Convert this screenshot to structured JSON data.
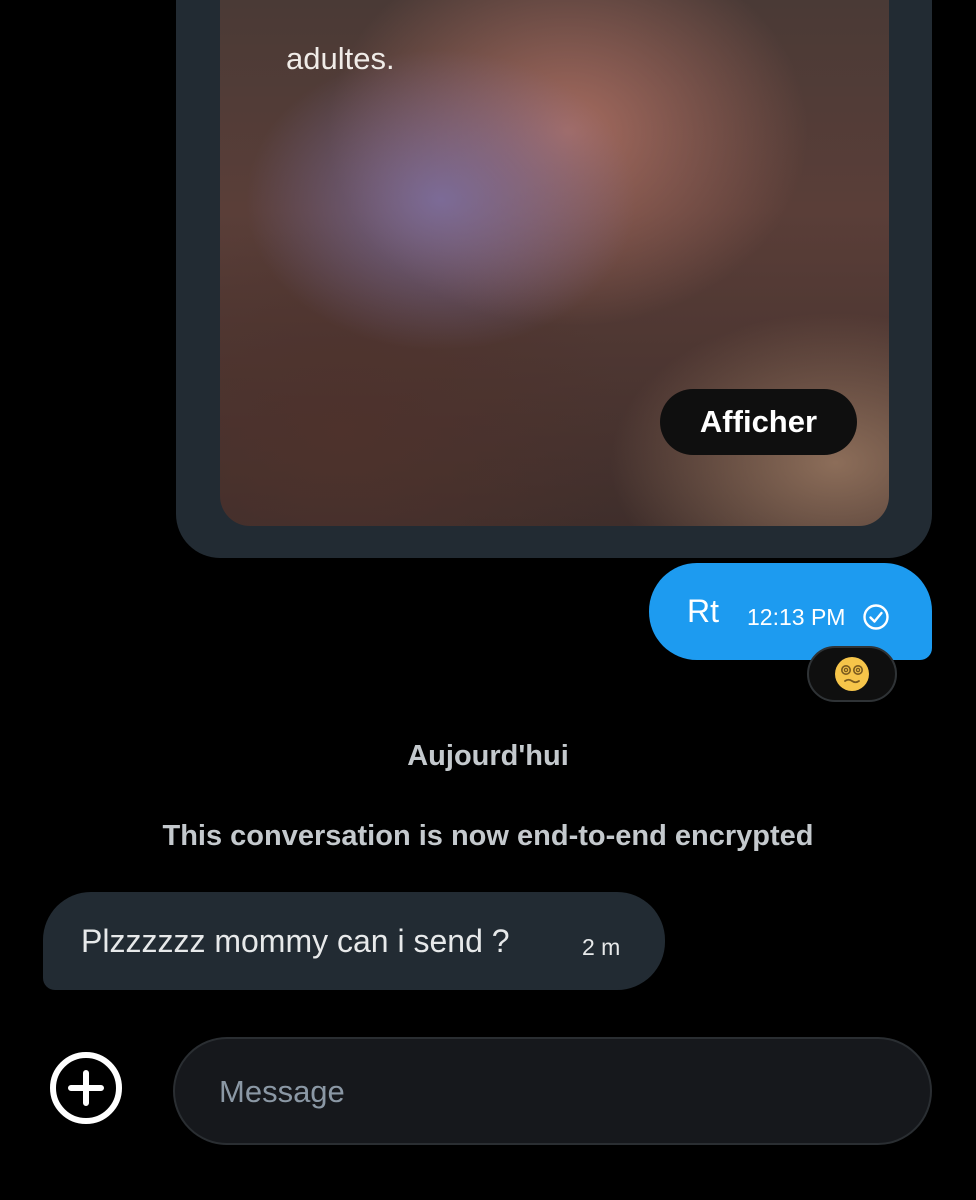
{
  "media": {
    "caption": "adultes.",
    "show_label": "Afficher"
  },
  "outgoing_message": {
    "text": "Rt",
    "time": "12:13 PM",
    "status_icon": "check-circle-icon",
    "reaction_icon": "dizzy-face-emoji"
  },
  "date_separator": "Aujourd'hui",
  "system_note": "This conversation is now end-to-end encrypted",
  "incoming_message": {
    "text": "Plzzzzzz mommy can i send ?",
    "time": "2 m"
  },
  "composer": {
    "placeholder": "Message",
    "value": "",
    "add_icon": "plus-circle-icon"
  },
  "colors": {
    "background": "#000000",
    "outgoing_bubble": "#1d9bf0",
    "incoming_bubble": "#222b33",
    "media_frame": "#222b33",
    "muted_text": "#8b98a5"
  }
}
